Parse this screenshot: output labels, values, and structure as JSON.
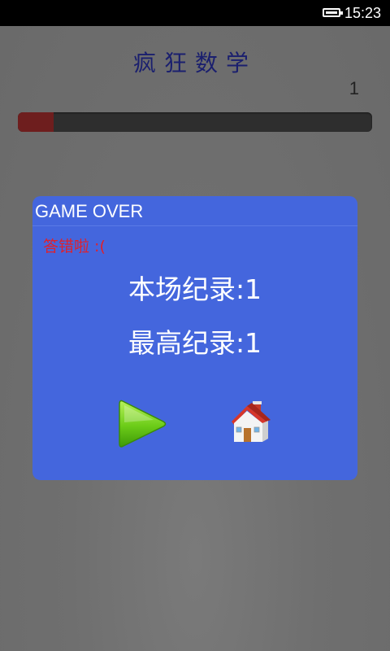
{
  "status_bar": {
    "time": "15:23",
    "battery_icon": "battery-icon"
  },
  "game": {
    "title": "疯狂数学",
    "score": "1",
    "progress": 0.1,
    "progress_color": "#6e1e1e"
  },
  "dialog": {
    "title": "GAME OVER",
    "message": "答错啦 :(",
    "current_score_line": "本场纪录:1",
    "best_score_line": "最高纪录:1",
    "background": "#4466dd",
    "play_icon": "play-icon",
    "home_icon": "home-icon"
  }
}
